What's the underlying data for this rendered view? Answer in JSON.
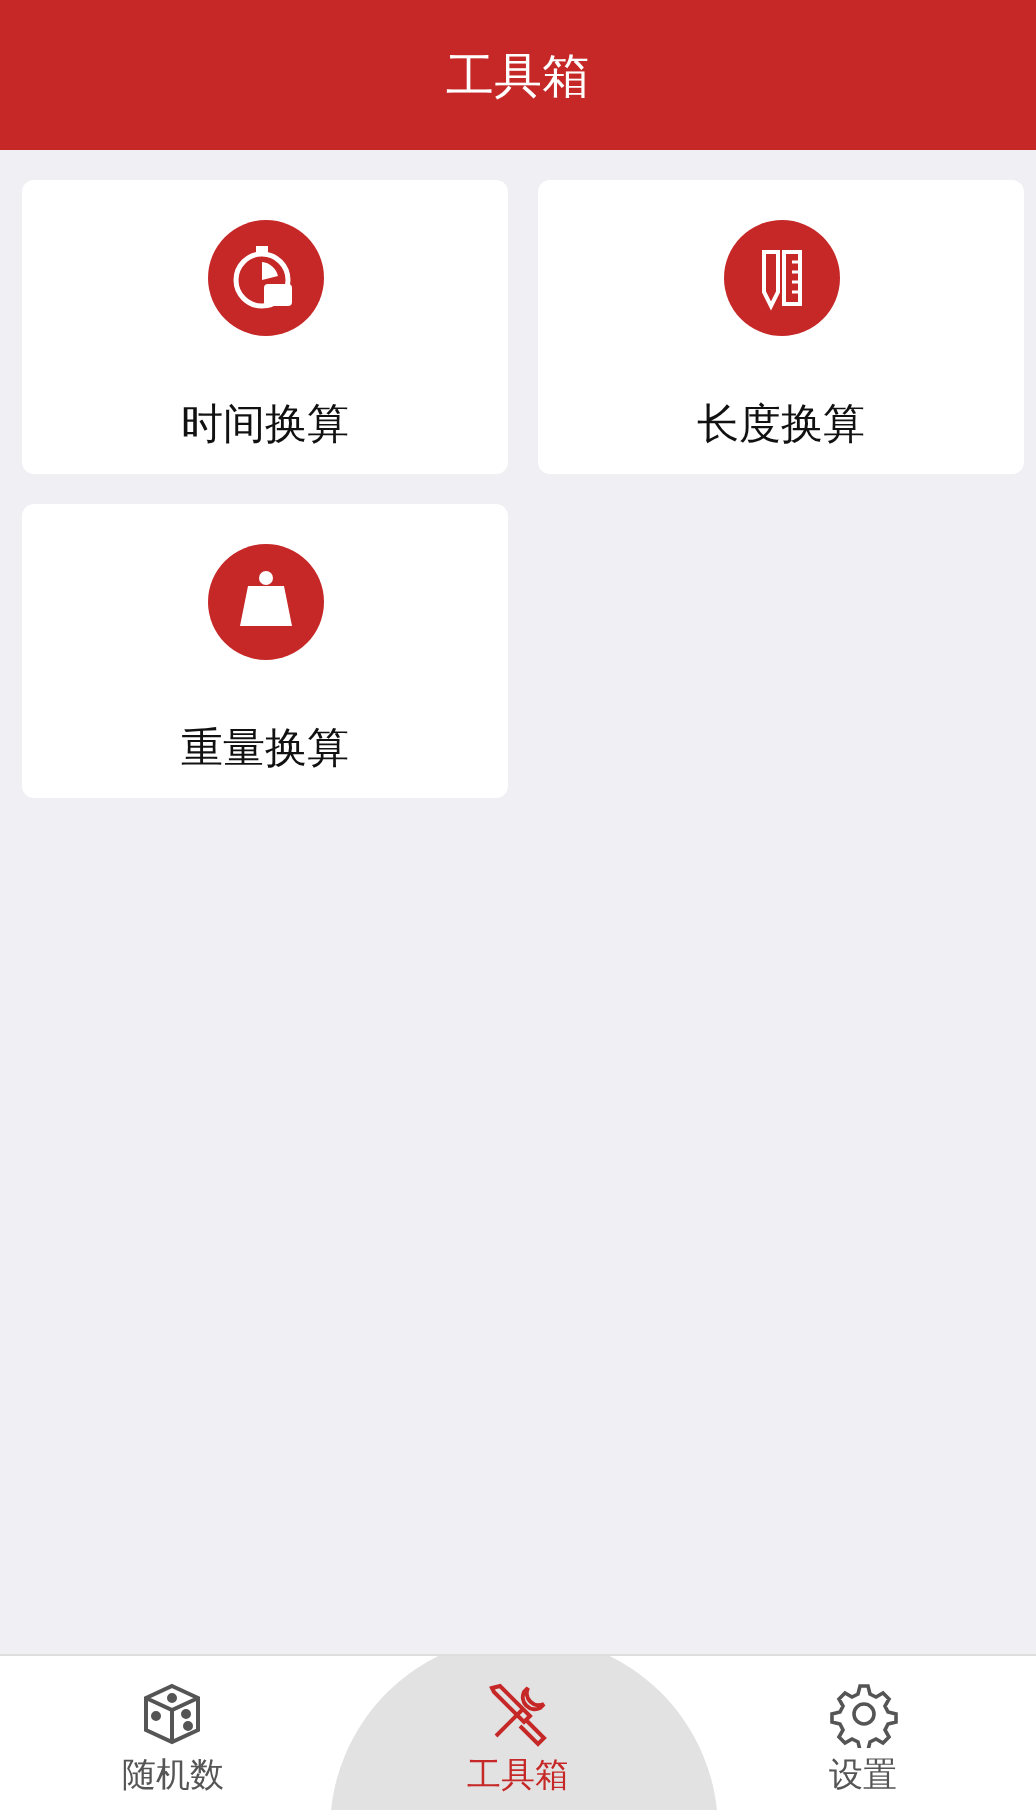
{
  "header": {
    "title": "工具箱"
  },
  "tools": [
    {
      "kind": "stopwatch",
      "label": "时间换算"
    },
    {
      "kind": "ruler",
      "label": "长度换算"
    },
    {
      "kind": "weight",
      "label": "重量换算"
    }
  ],
  "tabbar": [
    {
      "kind": "dice",
      "label": "随机数",
      "selected": false
    },
    {
      "kind": "tools",
      "label": "工具箱",
      "selected": true
    },
    {
      "kind": "gear",
      "label": "设置",
      "selected": false
    }
  ]
}
